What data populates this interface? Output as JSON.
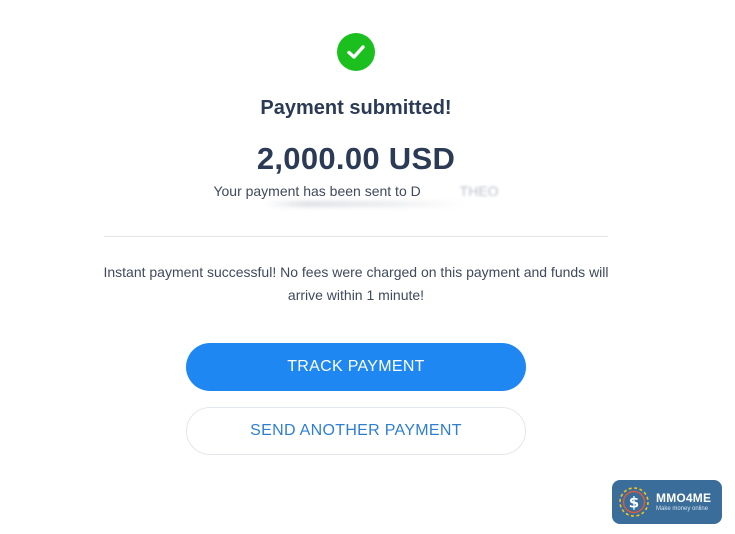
{
  "status": {
    "icon": "check-circle-icon",
    "title": "Payment submitted!",
    "amount": "2,000.00 USD",
    "sent_prefix": "Your payment has been sent to ",
    "recipient": "D",
    "recipient_suffix": "THEO"
  },
  "info": {
    "message": "Instant payment successful! No fees were charged on this payment and funds will arrive within 1 minute!"
  },
  "actions": {
    "track_label": "TRACK PAYMENT",
    "send_another_label": "SEND ANOTHER PAYMENT"
  },
  "watermark": {
    "brand": "MMO4ME",
    "tagline": "Make money online"
  },
  "colors": {
    "success": "#1bc01f",
    "primary": "#1f87f2",
    "text_dark": "#2b3a55",
    "watermark_bg": "#3b6d9a"
  }
}
